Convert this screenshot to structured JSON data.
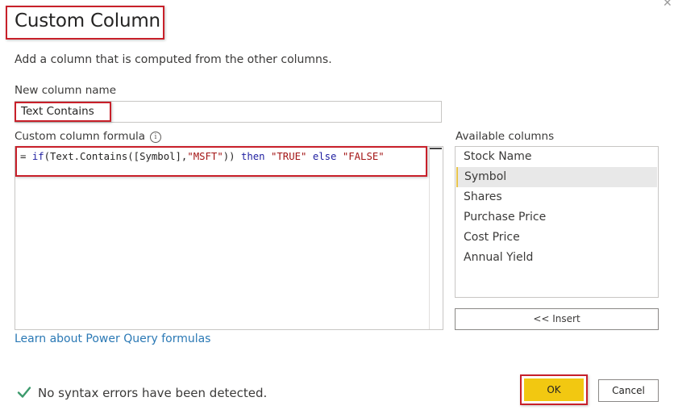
{
  "dialog": {
    "title": "Custom Column",
    "close_icon": "close-icon",
    "subtitle": "Add a column that is computed from the other columns."
  },
  "new_column": {
    "label": "New column name",
    "value": "Text Contains"
  },
  "formula": {
    "label": "Custom column formula",
    "info_icon": "info-icon",
    "tokens": [
      {
        "text": "= ",
        "type": "plain"
      },
      {
        "text": "if",
        "type": "kw"
      },
      {
        "text": "(Text.Contains([Symbol],",
        "type": "plain"
      },
      {
        "text": "\"MSFT\"",
        "type": "str"
      },
      {
        "text": ")) ",
        "type": "plain"
      },
      {
        "text": "then",
        "type": "kw"
      },
      {
        "text": " ",
        "type": "plain"
      },
      {
        "text": "\"TRUE\"",
        "type": "str"
      },
      {
        "text": " ",
        "type": "plain"
      },
      {
        "text": "else",
        "type": "kw"
      },
      {
        "text": " ",
        "type": "plain"
      },
      {
        "text": "\"FALSE\"",
        "type": "str"
      }
    ],
    "full_text": "= if(Text.Contains([Symbol],\"MSFT\")) then \"TRUE\" else \"FALSE\""
  },
  "available_columns": {
    "label": "Available columns",
    "items": [
      {
        "label": "Stock Name",
        "selected": false
      },
      {
        "label": "Symbol",
        "selected": true
      },
      {
        "label": "Shares",
        "selected": false
      },
      {
        "label": "Purchase Price",
        "selected": false
      },
      {
        "label": "Cost Price",
        "selected": false
      },
      {
        "label": "Annual Yield",
        "selected": false
      }
    ],
    "insert_label": "<< Insert"
  },
  "learn_link": "Learn about Power Query formulas",
  "status": {
    "icon": "check-icon",
    "text": "No syntax errors have been detected.",
    "color": "#3c9a6c"
  },
  "buttons": {
    "ok_label": "OK",
    "cancel_label": "Cancel",
    "ok_color": "#f2c811"
  },
  "highlight_color": "#c8202a"
}
